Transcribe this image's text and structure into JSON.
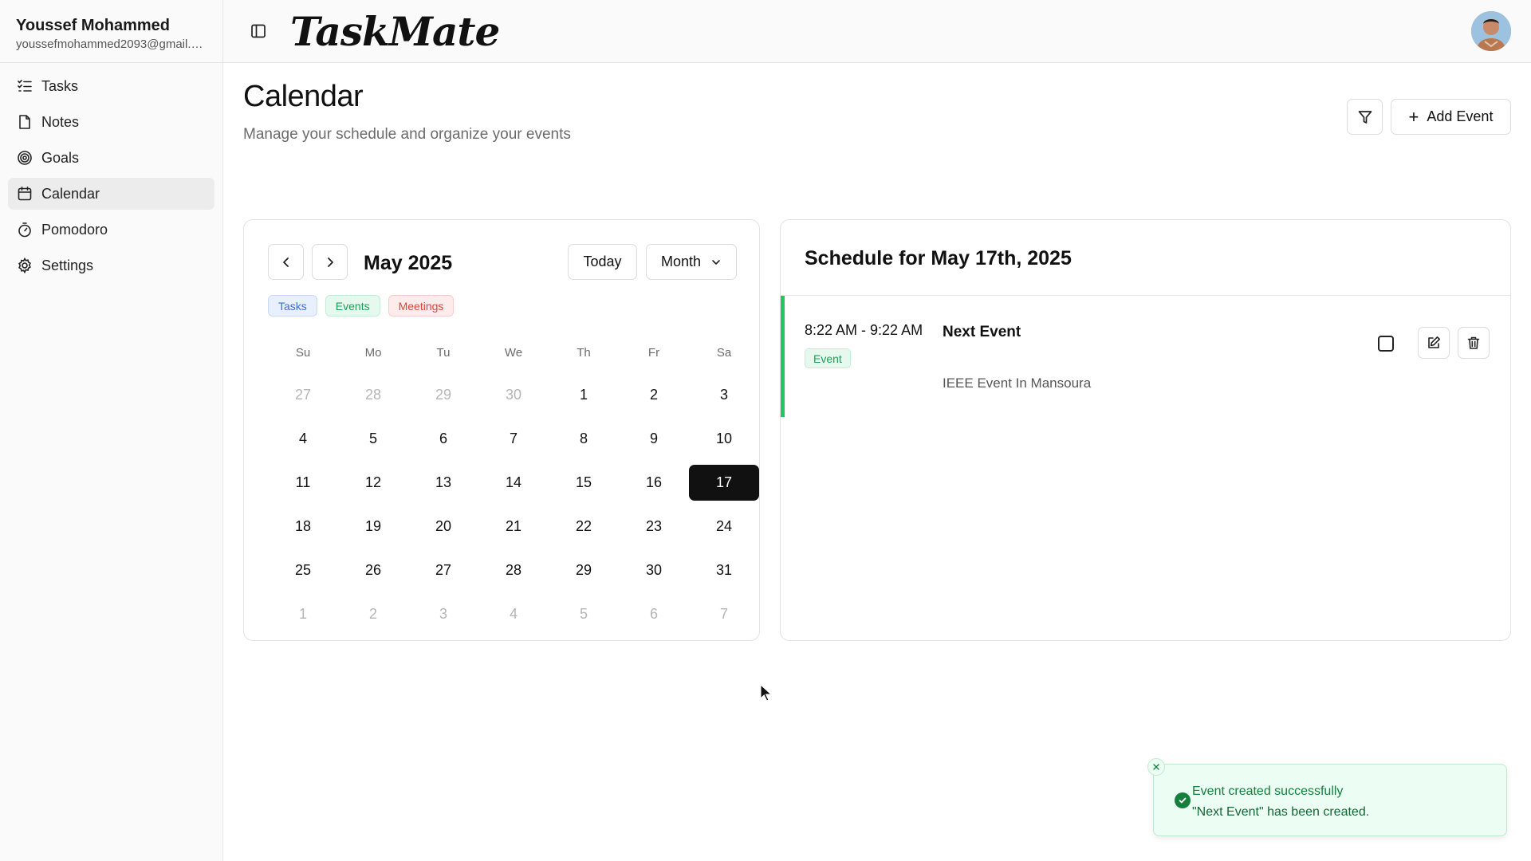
{
  "user": {
    "name": "Youssef Mohammed",
    "email": "youssefmohammed2093@gmail.com"
  },
  "sidebar": {
    "items": [
      {
        "label": "Tasks",
        "icon": "list-checks-icon",
        "active": false
      },
      {
        "label": "Notes",
        "icon": "file-icon",
        "active": false
      },
      {
        "label": "Goals",
        "icon": "target-icon",
        "active": false
      },
      {
        "label": "Calendar",
        "icon": "calendar-icon",
        "active": true
      },
      {
        "label": "Pomodoro",
        "icon": "timer-icon",
        "active": false
      },
      {
        "label": "Settings",
        "icon": "gear-icon",
        "active": false
      }
    ]
  },
  "header": {
    "brand": "TaskMate"
  },
  "page": {
    "title": "Calendar",
    "subtitle": "Manage your schedule and organize your events",
    "add_event_label": "Add Event"
  },
  "calendar": {
    "month_label": "May 2025",
    "today_label": "Today",
    "view_label": "Month",
    "legend": {
      "tasks": "Tasks",
      "events": "Events",
      "meetings": "Meetings"
    },
    "weekdays": [
      "Su",
      "Mo",
      "Tu",
      "We",
      "Th",
      "Fr",
      "Sa"
    ],
    "weeks": [
      [
        "27",
        "28",
        "29",
        "30",
        "1",
        "2",
        "3"
      ],
      [
        "4",
        "5",
        "6",
        "7",
        "8",
        "9",
        "10"
      ],
      [
        "11",
        "12",
        "13",
        "14",
        "15",
        "16",
        "17"
      ],
      [
        "18",
        "19",
        "20",
        "21",
        "22",
        "23",
        "24"
      ],
      [
        "25",
        "26",
        "27",
        "28",
        "29",
        "30",
        "31"
      ],
      [
        "1",
        "2",
        "3",
        "4",
        "5",
        "6",
        "7"
      ]
    ],
    "selected_day": "17"
  },
  "schedule": {
    "title": "Schedule for May 17th, 2025",
    "events": [
      {
        "time": "8:22 AM - 9:22 AM",
        "tag": "Event",
        "title": "Next Event",
        "description": "IEEE Event In Mansoura"
      }
    ]
  },
  "toast": {
    "title": "Event created successfully",
    "message": "\"Next Event\" has been created."
  },
  "colors": {
    "event_accent": "#22c55e",
    "selected_day_bg": "#111111",
    "toast_bg": "#ecfdf3",
    "toast_text": "#15803d"
  }
}
